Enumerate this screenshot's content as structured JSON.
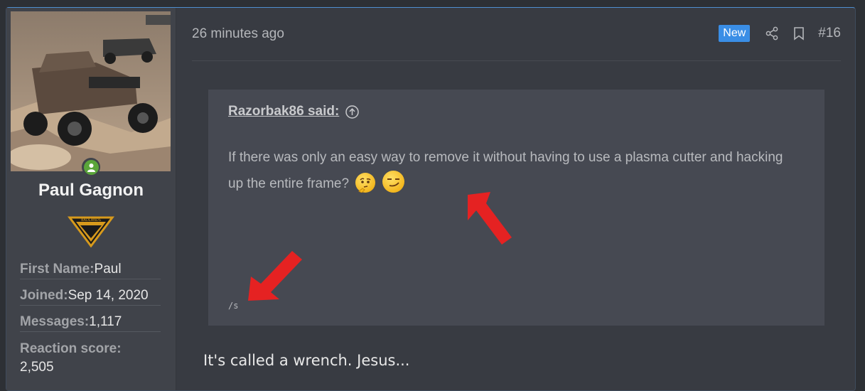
{
  "user": {
    "name": "Paul Gagnon",
    "badge_text": "BADLANDS",
    "fields": [
      {
        "label": "First Name:",
        "value": "Paul"
      },
      {
        "label": "Joined:",
        "value": "Sep 14, 2020"
      },
      {
        "label": "Messages:",
        "value": "1,117"
      },
      {
        "label": "Reaction score:",
        "value": "2,505"
      }
    ]
  },
  "post": {
    "timestamp": "26 minutes ago",
    "new_label": "New",
    "number": "#16",
    "quote": {
      "author": "Razorbak86 said:",
      "text": "If there was only an easy way to remove it without having to use a plasma cutter and hacking up the entire frame?",
      "signature": "/s"
    },
    "reply_text": "It's called a wrench. Jesus..."
  },
  "icons": [
    "share-icon",
    "bookmark-icon",
    "arrow-up-circle-icon",
    "thinking-face-emoji",
    "smirk-face-emoji",
    "online-status-icon"
  ],
  "colors": {
    "accent": "#3a8ee6",
    "online": "#5aa53a",
    "annotation_arrow": "#e52222"
  }
}
